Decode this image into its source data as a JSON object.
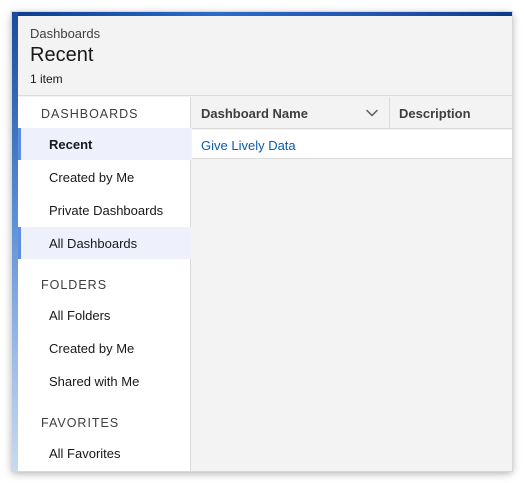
{
  "header": {
    "breadcrumb": "Dashboards",
    "title": "Recent",
    "count": "1 item"
  },
  "sidebar": {
    "sections": [
      {
        "heading": "DASHBOARDS"
      },
      {
        "heading": "FOLDERS"
      },
      {
        "heading": "FAVORITES"
      }
    ],
    "items": [
      {
        "label": "Recent",
        "state": "selected"
      },
      {
        "label": "Created by Me"
      },
      {
        "label": "Private Dashboards"
      },
      {
        "label": "All Dashboards",
        "state": "highlighted"
      },
      {
        "label": "All Folders"
      },
      {
        "label": "Created by Me"
      },
      {
        "label": "Shared with Me"
      },
      {
        "label": "All Favorites"
      }
    ]
  },
  "table": {
    "columns": [
      {
        "label": "Dashboard Name",
        "icon": "chevron-down-icon"
      },
      {
        "label": "Description"
      }
    ],
    "rows": [
      {
        "name": "Give Lively Data",
        "description": ""
      }
    ]
  },
  "colors": {
    "link": "#0b5cab",
    "accent": "#5b8ee0",
    "selected_bg": "#eef1fb"
  }
}
